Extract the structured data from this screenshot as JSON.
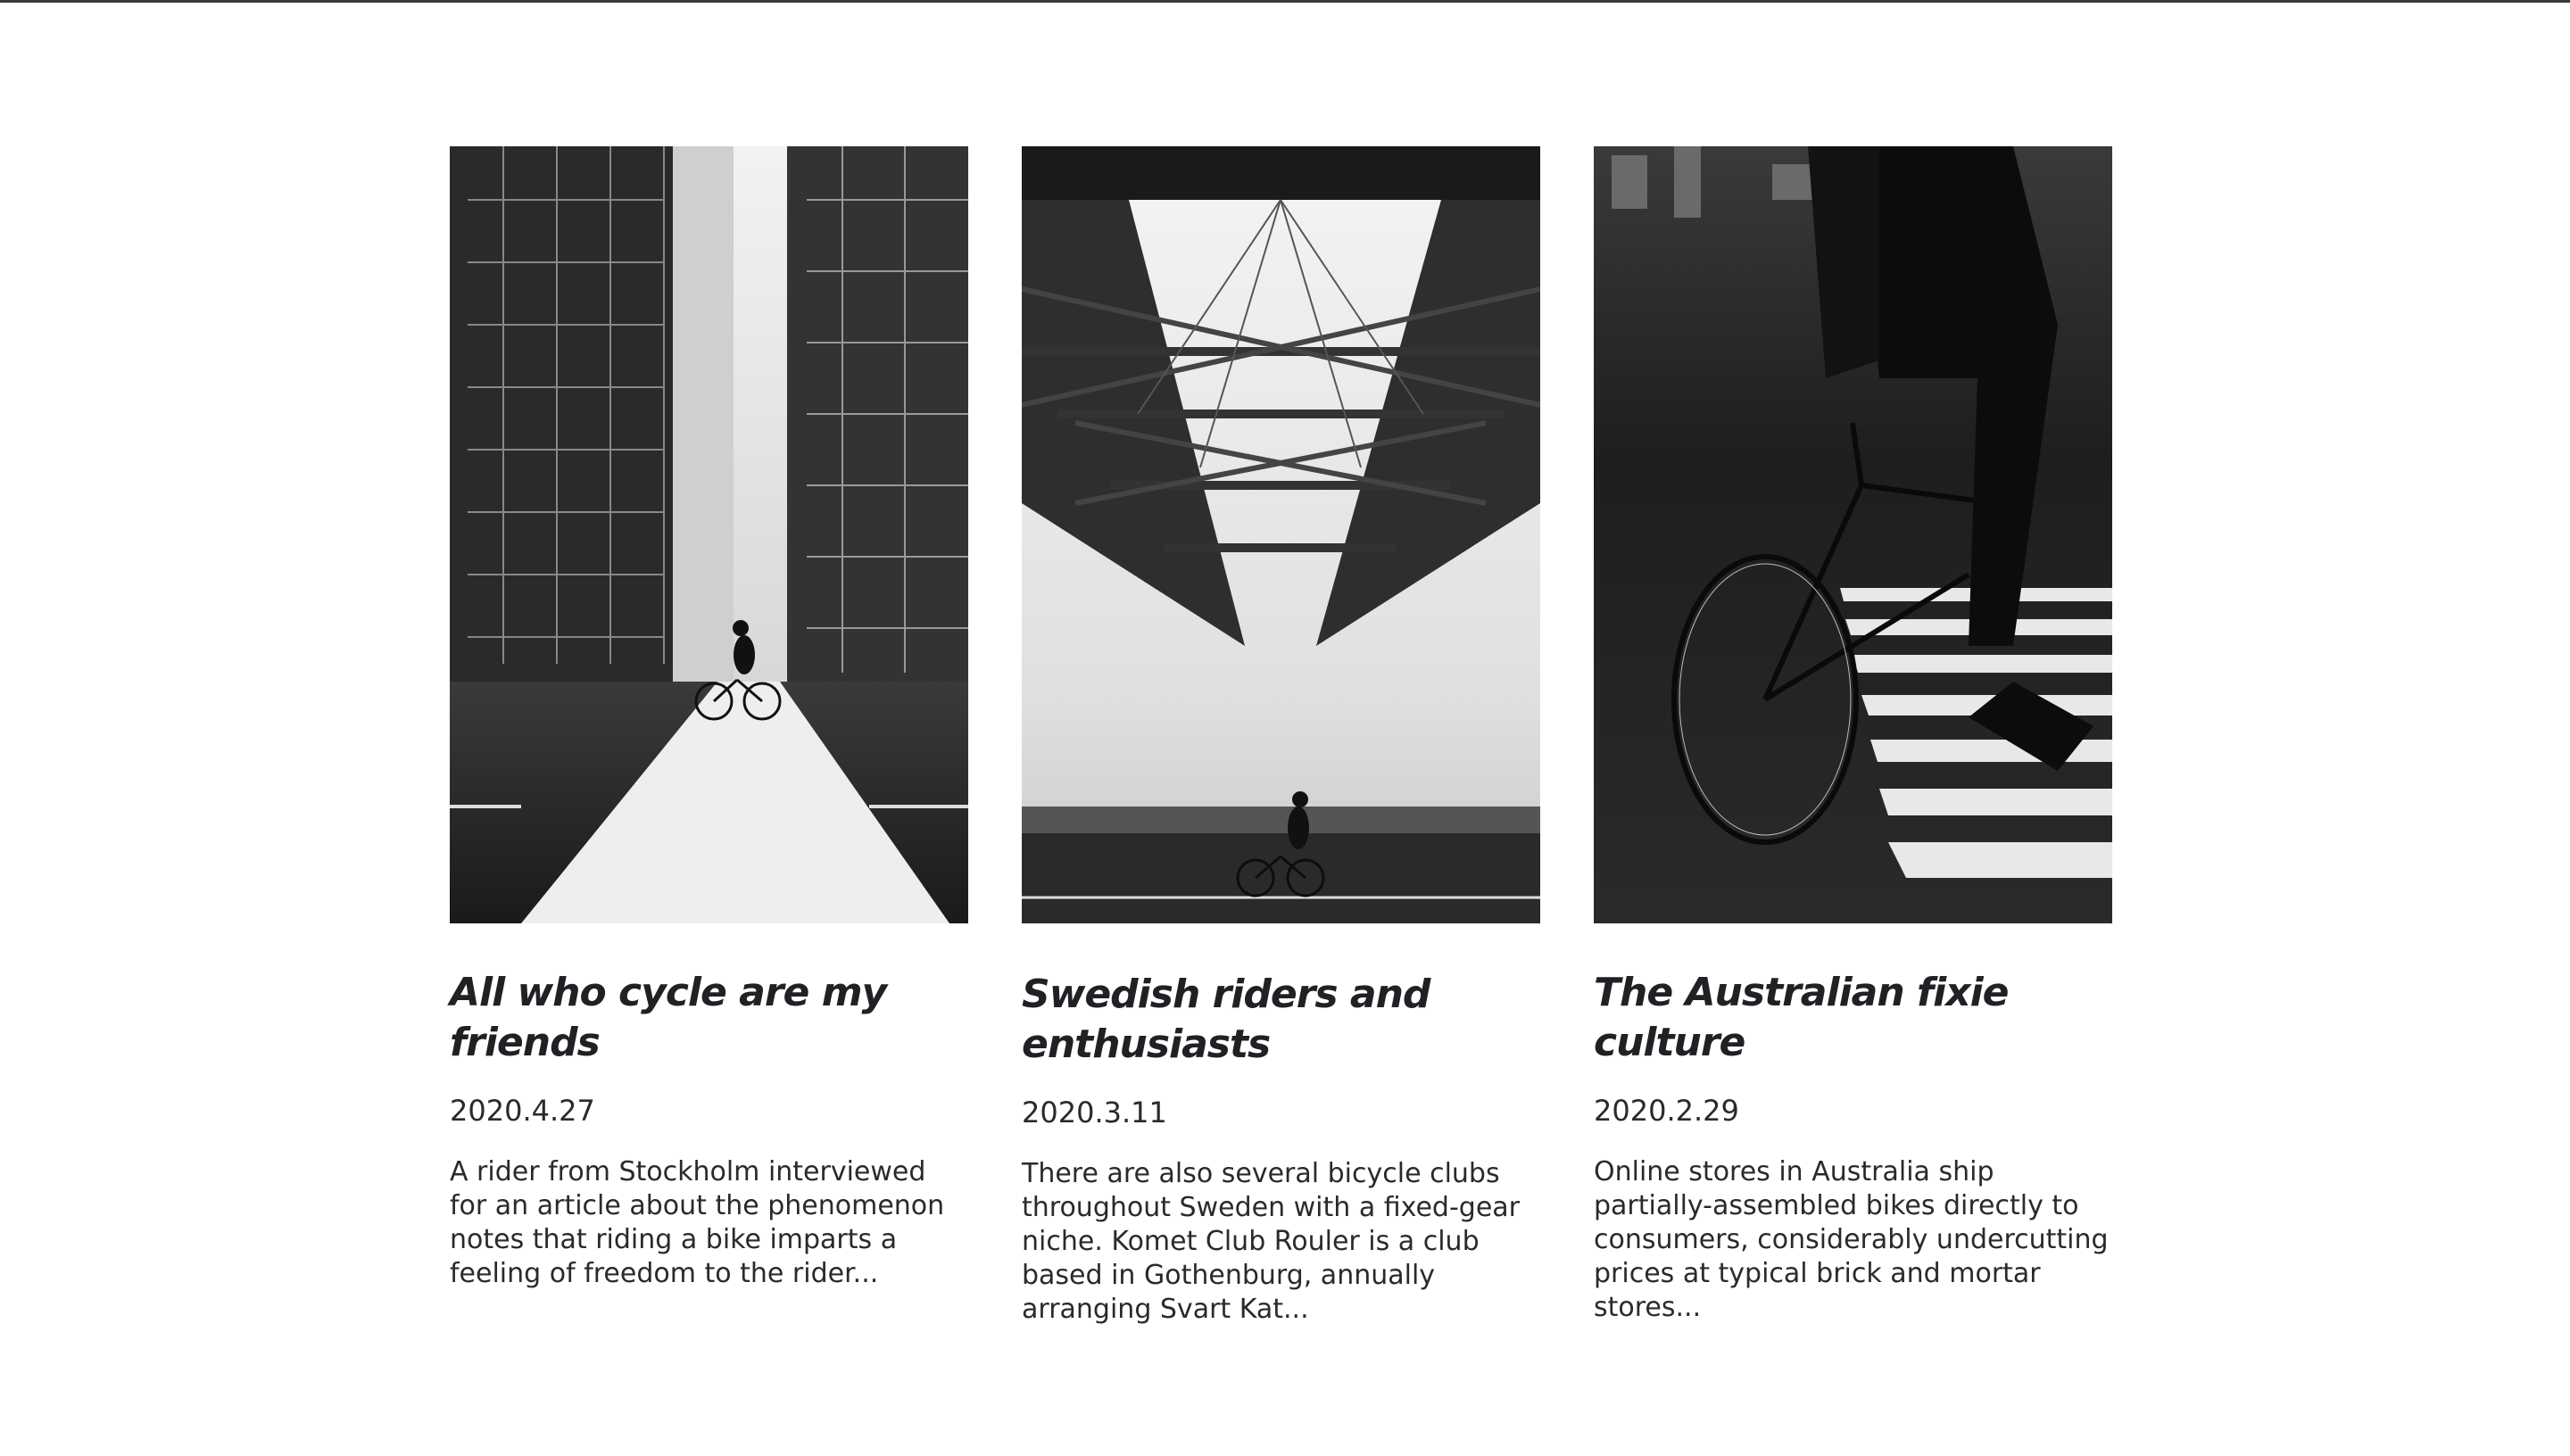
{
  "articles": [
    {
      "title": "All who cycle are my friends",
      "date": "2020.4.27",
      "excerpt": "A rider from Stockholm interviewed for an article about the phenomenon notes that riding a bike imparts a feeling of freedom to the rider..."
    },
    {
      "title": "Swedish riders and enthusiasts",
      "date": "2020.3.11",
      "excerpt": "There are also several bicycle clubs throughout Sweden with a fixed-gear niche. Komet Club Rouler is a club based in Gothenburg, annually arranging Svart Kat..."
    },
    {
      "title": "The Australian fixie culture",
      "date": "2020.2.29",
      "excerpt": "Online stores in Australia ship partially-assembled bikes directly to consumers, considerably undercutting prices at typical brick and mortar stores..."
    }
  ],
  "colors": {
    "text": "#202124",
    "background": "#ffffff",
    "top_rule": "#3a3a3a"
  }
}
